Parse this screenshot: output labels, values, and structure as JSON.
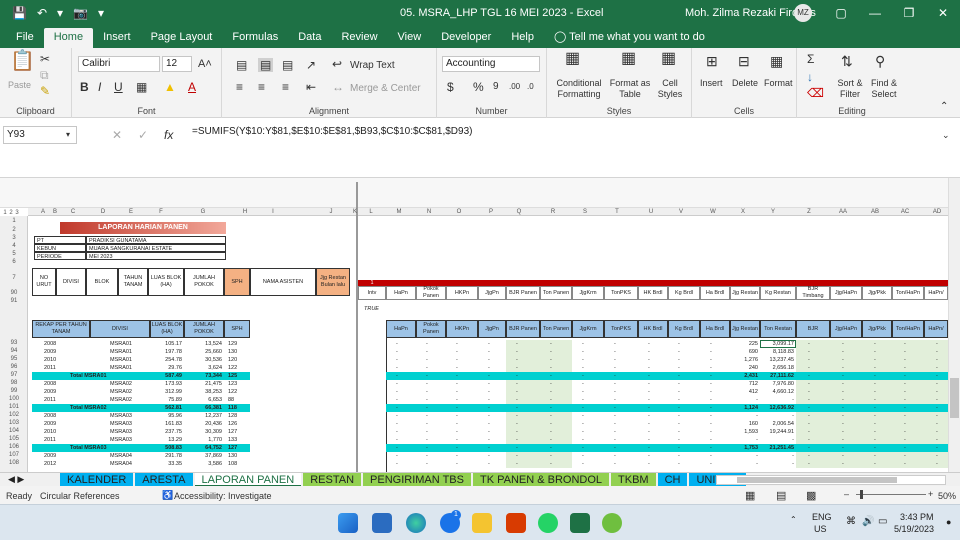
{
  "window": {
    "title": "05. MSRA_LHP TGL 16 MEI 2023  -  Excel",
    "user": "Moh. Zilma Rezaki Firdaus",
    "user_initials": "MZ"
  },
  "menu_tabs": [
    "File",
    "Home",
    "Insert",
    "Page Layout",
    "Formulas",
    "Data",
    "Review",
    "View",
    "Developer",
    "Help",
    "Tell me what you want to do"
  ],
  "ribbon": {
    "clipboard": {
      "paste": "Paste",
      "label": "Clipboard"
    },
    "font": {
      "name": "Calibri",
      "size": "12",
      "label": "Font"
    },
    "alignment": {
      "wrap": "Wrap Text",
      "merge": "Merge & Center",
      "label": "Alignment"
    },
    "number": {
      "format": "Accounting",
      "label": "Number"
    },
    "styles": {
      "conditional": "Conditional Formatting",
      "format_table": "Format as Table",
      "cell_styles": "Cell Styles",
      "label": "Styles"
    },
    "cells": {
      "insert": "Insert",
      "delete": "Delete",
      "format": "Format",
      "label": "Cells"
    },
    "editing": {
      "sort": "Sort & Filter",
      "find": "Find & Select",
      "label": "Editing"
    }
  },
  "formula_bar": {
    "name_box": "Y93",
    "formula": "=SUMIFS(Y$10:Y$81,$E$10:$E$81,$B93,$C$10:$C$81,$D93)"
  },
  "sheet": {
    "col_letters": [
      "A",
      "B",
      "C",
      "D",
      "E",
      "F",
      "G",
      "H",
      "I",
      "J",
      "K",
      "L",
      "M",
      "N",
      "O",
      "P",
      "Q",
      "R",
      "S",
      "T",
      "U",
      "V",
      "W",
      "X",
      "Y",
      "Z",
      "AA",
      "AB",
      "AC",
      "AD"
    ],
    "report_title": "LAPORAN HARIAN PANEN",
    "info": [
      [
        "PT",
        "PRADIKSI GUNATAMA"
      ],
      [
        "KEBUN",
        "MUARA SANGKURANAI ESTATE"
      ],
      [
        "PERIODE",
        "MEI 2023"
      ]
    ],
    "main_headers": [
      "NO URUT",
      "DIVISI",
      "BLOK",
      "TAHUN TANAM",
      "LUAS BLOK (HA)",
      "JUMLAH POKOK",
      "SPH",
      "NAMA ASISTEN",
      "Jjg Restan Bulan lalu"
    ],
    "right_marker": "1",
    "right_headers": [
      "Intv",
      "HaPn",
      "Pokok Panen",
      "HKPn",
      "JjgPn",
      "BJR Panen",
      "Ton Panen",
      "JjgKrm",
      "TonPKS",
      "HK Brdl",
      "Kg Brdl",
      "Ha Brdl",
      "Jjg Restan",
      "Kg Restan",
      "BJR Timbang",
      "Jjg/HaPn",
      "Jjg/Pkk",
      "Ton/HaPn",
      "HaPn/"
    ],
    "true_text": "TRUE",
    "rekap_headers": [
      "REKAP PER TAHUN TANAM",
      "DIVISI",
      "LUAS BLOK (HA)",
      "JUMLAH POKOK",
      "SPH"
    ],
    "rekap_right_headers": [
      "HaPn",
      "Pokok Panen",
      "HKPn",
      "JjgPn",
      "BJR Panen",
      "Ton Panen",
      "JjgKrm",
      "TonPKS",
      "HK Brdl",
      "Kg Brdl",
      "Ha Brdl",
      "Jjg Restan",
      "Ton Restan",
      "BJR",
      "Jjg/HaPn",
      "Jjg/Pkk",
      "Ton/HaPn",
      "HaPn/"
    ],
    "rows": [
      {
        "n": "93",
        "year": "2008",
        "div": "MSRA01",
        "luas": "105.17",
        "pokok": "13,524",
        "sph": "129",
        "jr": "225",
        "tr": "3,099.17"
      },
      {
        "n": "94",
        "year": "2009",
        "div": "MSRA01",
        "luas": "197.78",
        "pokok": "25,660",
        "sph": "130",
        "jr": "690",
        "tr": "8,118.83"
      },
      {
        "n": "95",
        "year": "2010",
        "div": "MSRA01",
        "luas": "254.78",
        "pokok": "30,536",
        "sph": "120",
        "jr": "1,276",
        "tr": "13,237.45"
      },
      {
        "n": "96",
        "year": "2011",
        "div": "MSRA01",
        "luas": "29.76",
        "pokok": "3,624",
        "sph": "122",
        "jr": "240",
        "tr": "2,656.18"
      },
      {
        "n": "97",
        "year": "Total MSRA01",
        "div": "",
        "luas": "587.49",
        "pokok": "73,344",
        "sph": "125",
        "jr": "2,431",
        "tr": "27,111.62",
        "total": true
      },
      {
        "n": "98",
        "year": "2008",
        "div": "MSRA02",
        "luas": "173.93",
        "pokok": "21,475",
        "sph": "123",
        "jr": "712",
        "tr": "7,976.80"
      },
      {
        "n": "99",
        "year": "2009",
        "div": "MSRA02",
        "luas": "312.99",
        "pokok": "38,253",
        "sph": "122",
        "jr": "412",
        "tr": "4,660.12"
      },
      {
        "n": "100",
        "year": "2011",
        "div": "MSRA02",
        "luas": "75.89",
        "pokok": "6,653",
        "sph": "88",
        "jr": "-",
        "tr": "-"
      },
      {
        "n": "101",
        "year": "Total MSRA02",
        "div": "",
        "luas": "562.81",
        "pokok": "66,381",
        "sph": "118",
        "jr": "1,124",
        "tr": "12,636.92",
        "total": true
      },
      {
        "n": "102",
        "year": "2008",
        "div": "MSRA03",
        "luas": "95.96",
        "pokok": "12,237",
        "sph": "128",
        "jr": "-",
        "tr": "-"
      },
      {
        "n": "103",
        "year": "2009",
        "div": "MSRA03",
        "luas": "161.83",
        "pokok": "20,436",
        "sph": "126",
        "jr": "160",
        "tr": "2,006.54"
      },
      {
        "n": "104",
        "year": "2010",
        "div": "MSRA03",
        "luas": "237.75",
        "pokok": "30,309",
        "sph": "127",
        "jr": "1,593",
        "tr": "19,244.91"
      },
      {
        "n": "105",
        "year": "2011",
        "div": "MSRA03",
        "luas": "13.29",
        "pokok": "1,770",
        "sph": "133",
        "jr": "-",
        "tr": "-"
      },
      {
        "n": "106",
        "year": "Total MSRA03",
        "div": "",
        "luas": "508.83",
        "pokok": "64,752",
        "sph": "127",
        "jr": "1,753",
        "tr": "21,251.45",
        "total": true
      },
      {
        "n": "107",
        "year": "2009",
        "div": "MSRA04",
        "luas": "291.78",
        "pokok": "37,869",
        "sph": "130",
        "jr": "-",
        "tr": "-"
      },
      {
        "n": "108",
        "year": "2012",
        "div": "MSRA04",
        "luas": "33.35",
        "pokok": "3,586",
        "sph": "108",
        "jr": "-",
        "tr": "-"
      }
    ]
  },
  "sheet_tabs": [
    "KALENDER",
    "ARESTA",
    "LAPORAN PANEN",
    "RESTAN",
    "PENGIRIMAN TBS",
    "TK PANEN & BRONDOL",
    "TKBM",
    "CH",
    "UNIT TE"
  ],
  "status": {
    "ready": "Ready",
    "circ": "Circular References",
    "access": "Accessibility: Investigate",
    "zoom": "50%"
  },
  "taskbar": {
    "lang1": "ENG",
    "lang2": "US",
    "time": "3:43 PM",
    "date": "5/19/2023",
    "badge": "1"
  }
}
